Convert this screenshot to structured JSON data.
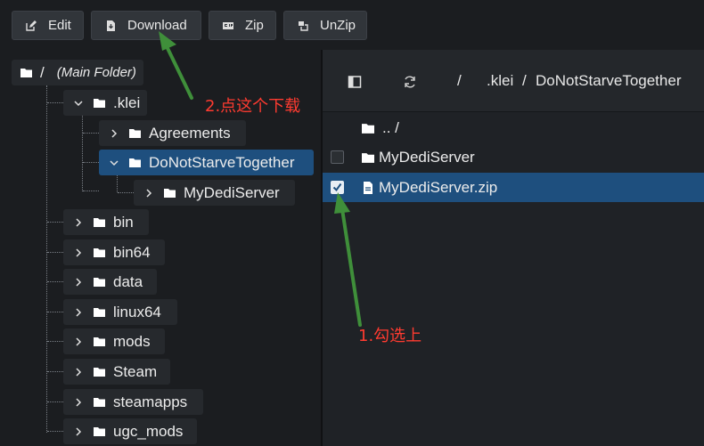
{
  "toolbar": {
    "buttons": [
      {
        "label": "Edit",
        "icon": "edit-icon"
      },
      {
        "label": "Download",
        "icon": "download-icon"
      },
      {
        "label": "Zip",
        "icon": "zip-icon"
      },
      {
        "label": "UnZip",
        "icon": "unzip-icon"
      }
    ]
  },
  "tree": {
    "root": {
      "label": "/",
      "sub": "(Main Folder)"
    },
    "klei": ".klei",
    "agreements": "Agreements",
    "dst": "DoNotStarveTogether",
    "mydedi": "MyDediServer",
    "items": [
      "bin",
      "bin64",
      "data",
      "linux64",
      "mods",
      "Steam",
      "steamapps",
      "ugc_mods"
    ]
  },
  "browser": {
    "breadcrumb": [
      "/",
      ".klei",
      "/",
      "DoNotStarveTogether"
    ],
    "rows": [
      {
        "label": ".. /",
        "type": "parent"
      },
      {
        "label": "MyDediServer",
        "type": "folder",
        "checked": false
      },
      {
        "label": "MyDediServer.zip",
        "type": "file",
        "checked": true
      }
    ]
  },
  "annotations": {
    "step2": "2.点这个下载",
    "step1": "1.勾选上"
  },
  "colors": {
    "accent": "#1e4f7e",
    "annotation": "#ff3b30",
    "arrow": "#3f8f3a"
  }
}
